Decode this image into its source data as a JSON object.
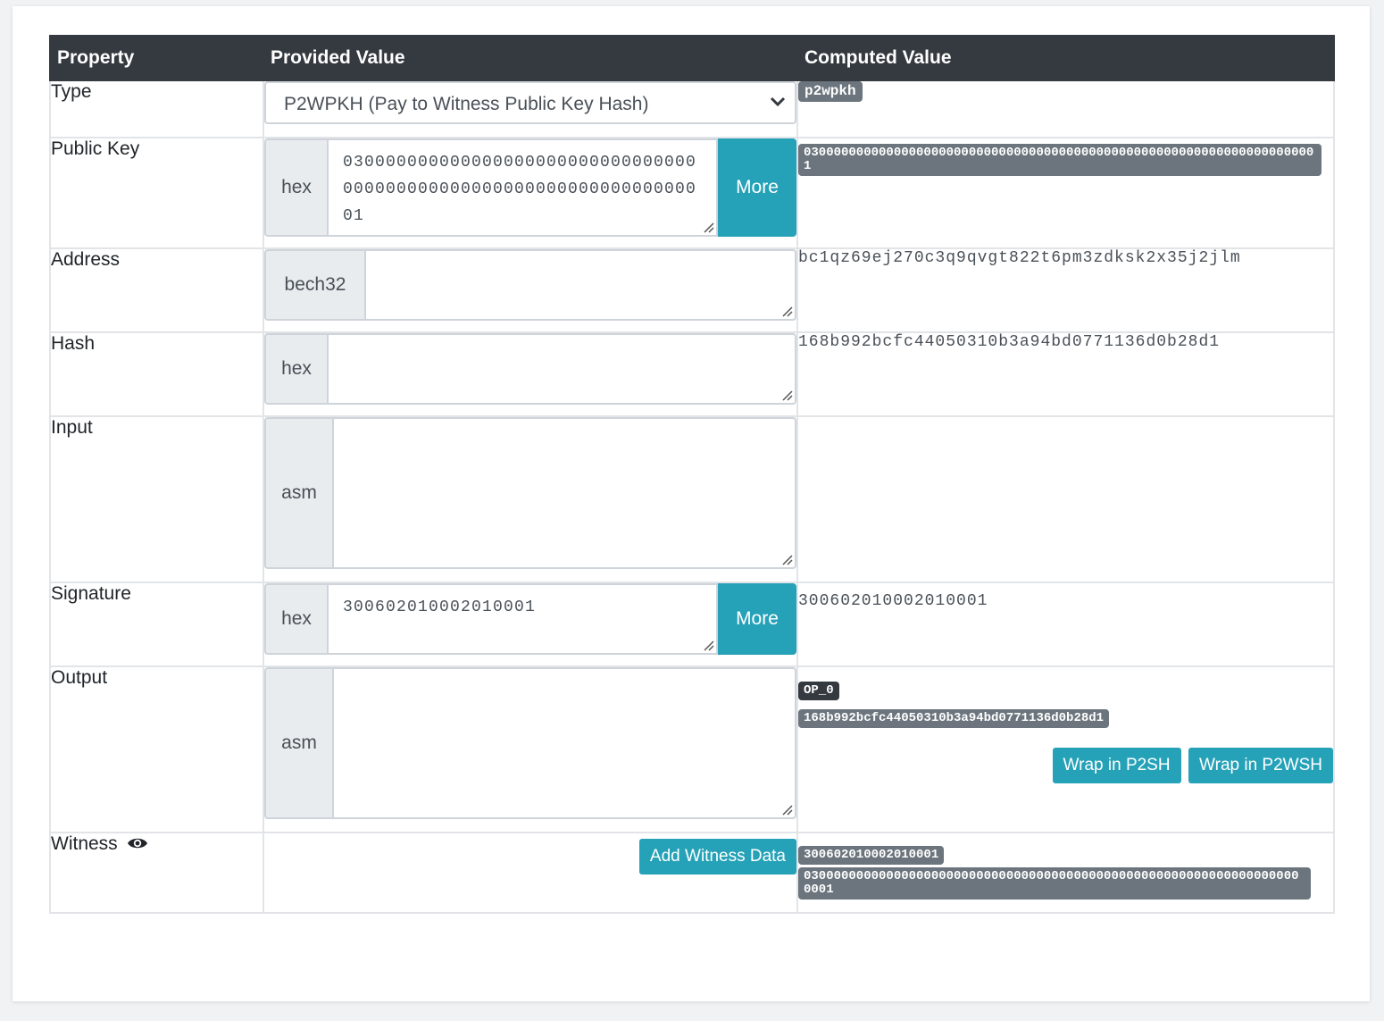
{
  "headers": {
    "property": "Property",
    "provided": "Provided Value",
    "computed": "Computed Value"
  },
  "rows": {
    "type": {
      "label": "Type",
      "select_value": "P2WPKH (Pay to Witness Public Key Hash)",
      "computed_badge": "p2wpkh"
    },
    "pubkey": {
      "label": "Public Key",
      "addon": "hex",
      "value": "03000000000000000000000000000000000000000000000000000000000000000001",
      "more": "More",
      "computed": "030000000000000000000000000000000000000000000000000000000000000000001"
    },
    "address": {
      "label": "Address",
      "addon": "bech32",
      "value": "",
      "computed": "bc1qz69ej270c3q9qvgt822t6pm3zdksk2x35j2jlm"
    },
    "hash": {
      "label": "Hash",
      "addon": "hex",
      "value": "",
      "computed": "168b992bcfc44050310b3a94bd0771136d0b28d1"
    },
    "input": {
      "label": "Input",
      "addon": "asm",
      "value": ""
    },
    "signature": {
      "label": "Signature",
      "addon": "hex",
      "value": "300602010002010001",
      "more": "More",
      "computed": "300602010002010001"
    },
    "output": {
      "label": "Output",
      "addon": "asm",
      "value": "",
      "computed_op": "OP_0",
      "computed_hash": "168b992bcfc44050310b3a94bd0771136d0b28d1",
      "wrap_p2sh": "Wrap in P2SH",
      "wrap_p2wsh": "Wrap in P2WSH"
    },
    "witness": {
      "label": "Witness",
      "add_button": "Add Witness Data",
      "item1": "300602010002010001",
      "item2": "0300000000000000000000000000000000000000000000000000000000000000000001"
    }
  },
  "icons": {
    "eye": "eye-icon",
    "chevron": "chevron-down-icon"
  },
  "colors": {
    "header_bg": "#343a40",
    "accent": "#26a2b8",
    "badge": "#6c757d"
  }
}
